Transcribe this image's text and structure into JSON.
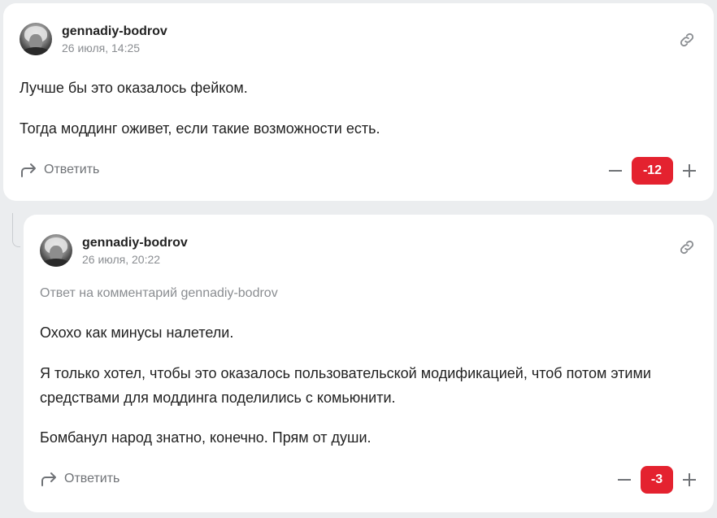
{
  "comments": [
    {
      "author": "gennadiy-bodrov",
      "date": "26 июля, 14:25",
      "paragraphs": [
        "Лучше бы это оказалось фейком.",
        "Тогда моддинг оживет, если такие возможности есть."
      ],
      "reply_label": "Ответить",
      "score": "-12"
    },
    {
      "author": "gennadiy-bodrov",
      "date": "26 июля, 20:22",
      "reply_to": "Ответ на комментарий gennadiy-bodrov",
      "paragraphs": [
        "Охохо как минусы налетели.",
        "Я только хотел, чтобы это оказалось пользовательской модификацией, чтоб потом этими средствами для моддинга поделились с комьюнити.",
        "Бомбанул народ знатно, конечно. Прям от души."
      ],
      "reply_label": "Ответить",
      "score": "-3"
    }
  ],
  "colors": {
    "score_bg": "#e4222f",
    "muted": "#8a8d91",
    "page_bg": "#ebedef"
  },
  "icons": [
    "link-icon",
    "reply-arrow-icon",
    "minus-icon",
    "plus-icon"
  ]
}
